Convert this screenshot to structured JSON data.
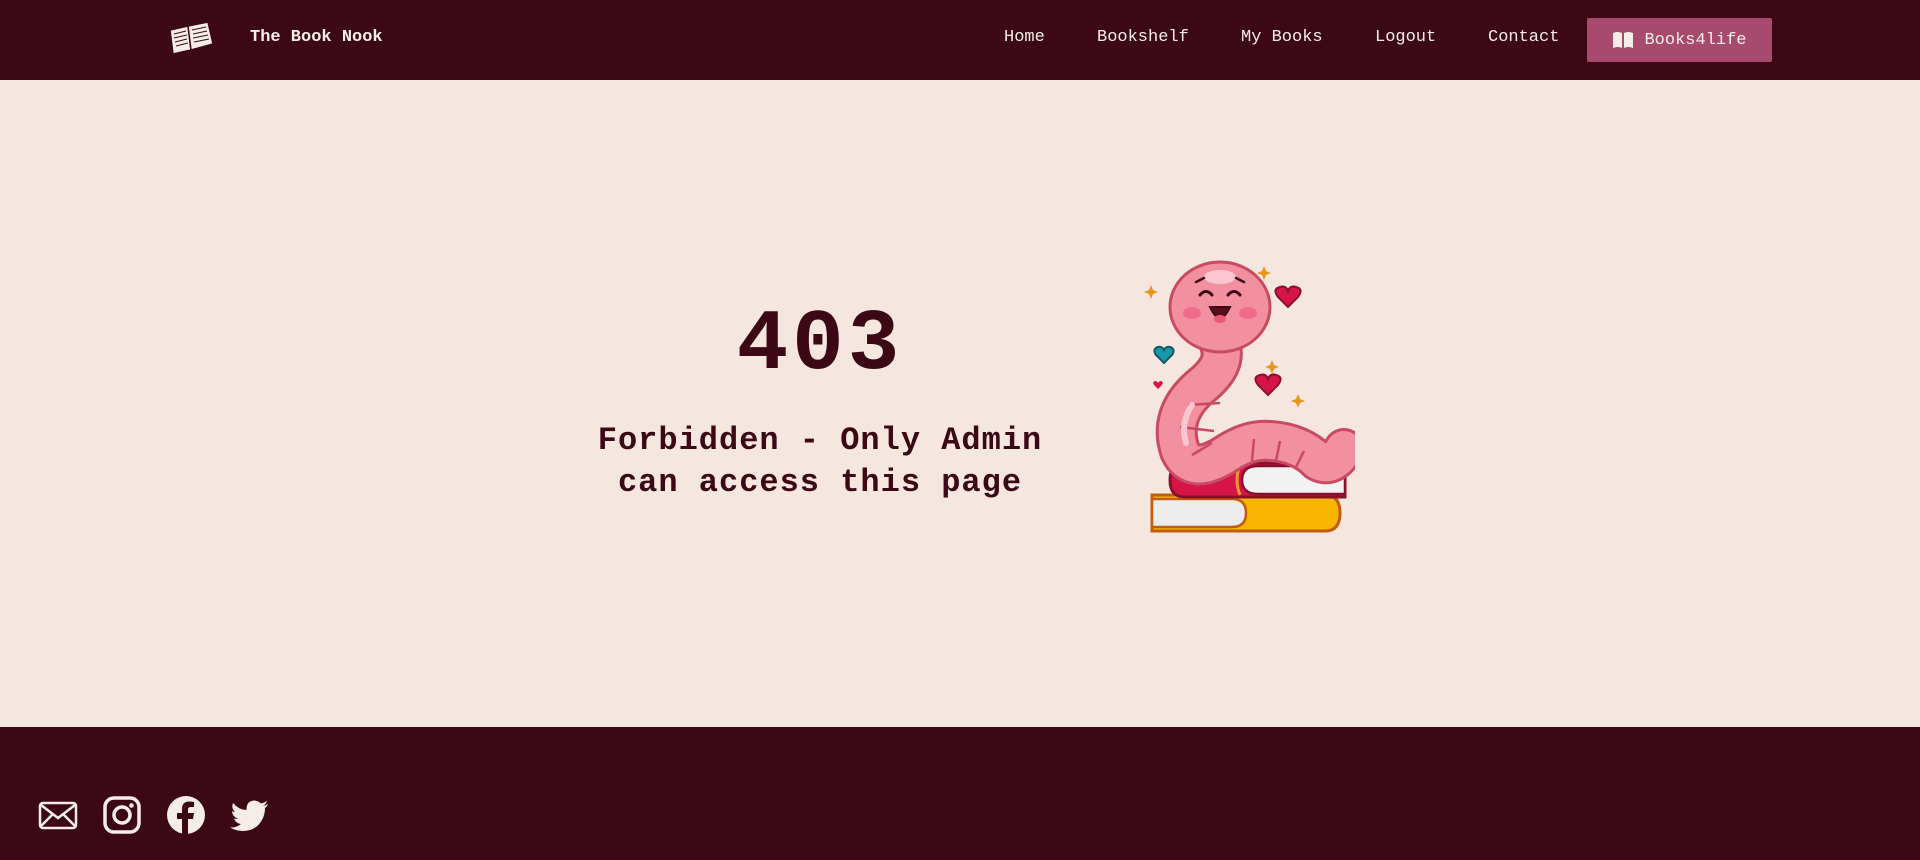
{
  "app": {
    "brand_name": "The Book Nook",
    "brand_icon": "open-book-icon"
  },
  "nav": {
    "items": [
      {
        "label": "Home"
      },
      {
        "label": "Bookshelf"
      },
      {
        "label": "My Books"
      },
      {
        "label": "Logout"
      },
      {
        "label": "Contact"
      }
    ],
    "cta": {
      "label": "Books4life",
      "icon": "book-icon"
    }
  },
  "error": {
    "code": "403",
    "message_line1": "Forbidden - Only Admin",
    "message_line2": "can access this page",
    "illustration": "bookworm-illustration"
  },
  "footer": {
    "social_icons": [
      "mail-icon",
      "instagram-icon",
      "facebook-icon",
      "twitter-icon"
    ]
  },
  "colors": {
    "header_bg": "#3c0816",
    "page_bg": "#f5e6df",
    "accent_button": "#a84a6e",
    "text_light": "#f7ede8",
    "text_dark": "#3c0816"
  }
}
